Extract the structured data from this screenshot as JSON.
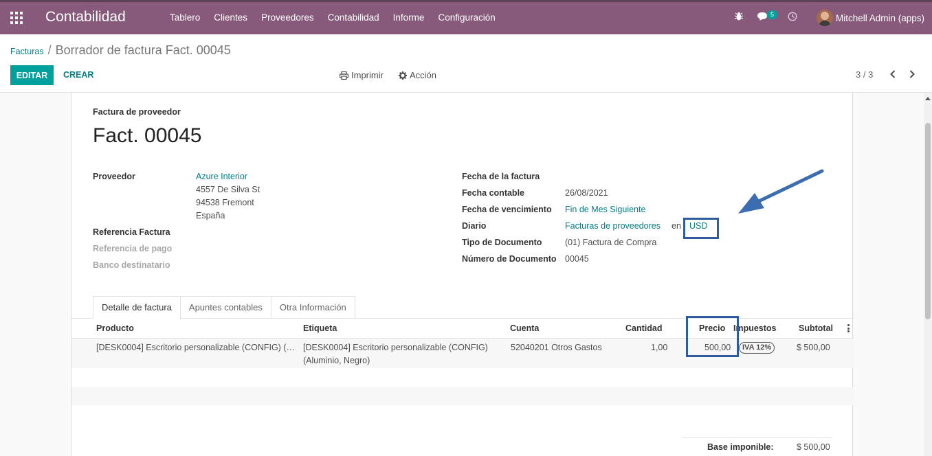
{
  "topbar": {
    "app_title": "Contabilidad",
    "menu": [
      "Tablero",
      "Clientes",
      "Proveedores",
      "Contabilidad",
      "Informe",
      "Configuración"
    ],
    "messages_count": "5",
    "user": "Mitchell Admin (apps)"
  },
  "breadcrumb": {
    "parent": "Facturas",
    "separator": "/",
    "current": "Borrador de factura Fact. 00045"
  },
  "toolbar": {
    "edit_label": "EDITAR",
    "create_label": "CREAR",
    "print_label": "Imprimir",
    "action_label": "Acción",
    "pager": "3 / 3"
  },
  "invoice": {
    "type_label": "Factura de proveedor",
    "name": "Fact. 00045",
    "left_fields": {
      "vendor_label": "Proveedor",
      "vendor_name": "Azure Interior",
      "address_line1": "4557 De Silva St",
      "address_line2": "94538 Fremont",
      "address_line3": "España",
      "ref_label": "Referencia Factura",
      "payment_ref_label": "Referencia de pago",
      "bank_label": "Banco destinatario"
    },
    "right_fields": {
      "invoice_date_label": "Fecha de la factura",
      "accounting_date_label": "Fecha contable",
      "accounting_date_value": "26/08/2021",
      "due_date_label": "Fecha de vencimiento",
      "due_date_value": "Fin de Mes Siguiente",
      "journal_label": "Diario",
      "journal_value": "Facturas de proveedores",
      "currency_prefix": "en",
      "currency_value": "USD",
      "doc_type_label": "Tipo de Documento",
      "doc_type_value": "(01) Factura de Compra",
      "doc_number_label": "Número de Documento",
      "doc_number_value": "00045"
    },
    "tabs": [
      "Detalle de factura",
      "Apuntes contables",
      "Otra Información"
    ],
    "lines": {
      "headers": {
        "product": "Producto",
        "label": "Etiqueta",
        "account": "Cuenta",
        "quantity": "Cantidad",
        "price": "Precio",
        "taxes": "Impuestos",
        "subtotal": "Subtotal"
      },
      "row": {
        "product": "[DESK0004] Escritorio personalizable (CONFIG) (…",
        "label_line1": "[DESK0004] Escritorio personalizable (CONFIG)",
        "label_line2": "(Aluminio, Negro)",
        "account": "52040201 Otros Gastos",
        "quantity": "1,00",
        "price": "500,00",
        "tax": "IVA 12%",
        "subtotal": "$ 500,00"
      }
    },
    "totals": {
      "base_label": "Base imponible:",
      "base_value": "$ 500,00"
    }
  },
  "colors": {
    "topbar": "#875a7b",
    "primary": "#00a09d",
    "link": "#017e84",
    "annotation": "#2e5c9e"
  }
}
